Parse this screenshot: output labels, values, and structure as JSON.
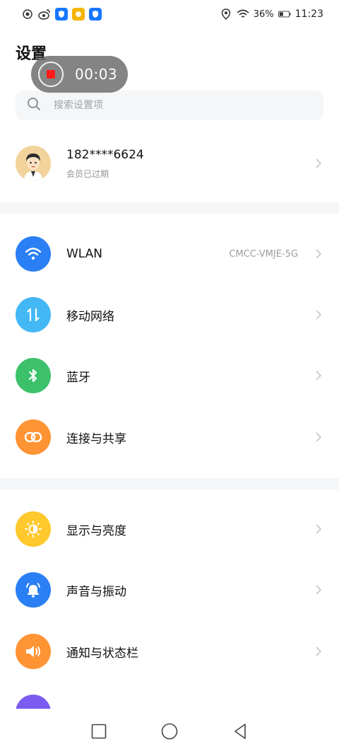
{
  "statusbar": {
    "battery": "36%",
    "time": "11:23"
  },
  "page": {
    "title": "设置"
  },
  "recording": {
    "timer": "00:03"
  },
  "search": {
    "placeholder": "搜索设置项"
  },
  "account": {
    "phone": "182****6624",
    "status": "会员已过期"
  },
  "sections": [
    {
      "items": [
        {
          "label": "WLAN",
          "value": "CMCC-VMJE-5G",
          "icon": "wifi-icon",
          "color": "#2b7ff5"
        },
        {
          "label": "移动网络",
          "value": "",
          "icon": "mobile-data-icon",
          "color": "#44b8f5"
        },
        {
          "label": "蓝牙",
          "value": "",
          "icon": "bluetooth-icon",
          "color": "#3cc16a"
        },
        {
          "label": "连接与共享",
          "value": "",
          "icon": "link-icon",
          "color": "#ff9434"
        }
      ]
    },
    {
      "items": [
        {
          "label": "显示与亮度",
          "value": "",
          "icon": "brightness-icon",
          "color": "#ffc82c"
        },
        {
          "label": "声音与振动",
          "value": "",
          "icon": "bell-icon",
          "color": "#2b7ff5"
        },
        {
          "label": "通知与状态栏",
          "value": "",
          "icon": "speaker-icon",
          "color": "#ff9434"
        }
      ]
    }
  ]
}
